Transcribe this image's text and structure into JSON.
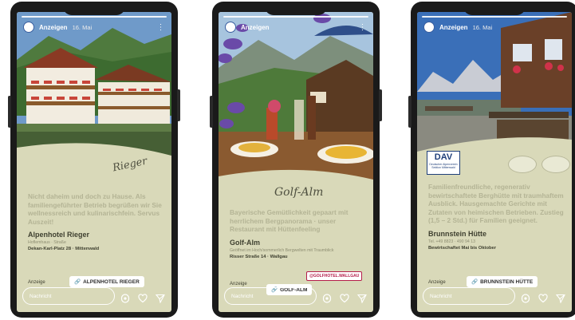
{
  "stories": [
    {
      "account": "Anzeigen",
      "date": "16. Mai",
      "description": "Nicht daheim und doch zu Hause. Als familiengeführter Betrieb begrüßen wir Sie wellnessreich und kulinarischfein. Servus Auszeit!",
      "name": "Alpenhotel Rieger",
      "address_small": "Hoflemhaus · Straße",
      "address": "Dekan-Karl-Platz 28 · Mittenwald",
      "ad_label": "Anzeige",
      "link_label": "ALPENHOTEL RIEGER",
      "reply_placeholder": "Nachricht",
      "logo_text": "Rieger"
    },
    {
      "account": "Anzeigen",
      "date": "",
      "tagline": "Golf-Alm",
      "description": "Bayerische Gemütlichkeit gepaart mit herrlichem Bergpanorama · unser Restaurant mit Hüttenfeeling",
      "name": "Golf-Alm",
      "address_small": "Geöffnet im Hoch/sommerlich Bergwelten mit Traumblick",
      "address": "Risser Straße 14 · Wallgau",
      "badge": "@GOLFHOTEL.WALLGAU",
      "ad_label": "Anzeige",
      "link_label": "GOLF-ALM",
      "reply_placeholder": "Nachricht"
    },
    {
      "account": "Anzeigen",
      "date": "16. Mai",
      "dav_label": "DAV",
      "dav_sub": "Deutscher Alpenverein Sektion Mittenwald",
      "description": "Familienfreundliche, regenerativ bewirtschaftete Berghütte mit traumhaftem Ausblick. Hausgemachte Gerichte mit Zutaten von heimischen Betrieben. Zustieg (1,5 – 2 Std.) für Familien geeignet.",
      "name": "Brunnstein Hütte",
      "address_small": "Tel. +49 8823 · 490 94 13",
      "address": "Bewirtschaftet Mai bis Oktober",
      "ad_label": "Anzeige",
      "link_label": "BRUNNSTEIN HÜTTE",
      "reply_placeholder": "Nachricht"
    }
  ],
  "colors": {
    "panel": "#d9d9b9",
    "desc": "#b4b495",
    "dark_text": "#3f4030"
  },
  "icons": [
    "camera-icon",
    "heart-icon",
    "send-icon",
    "link-icon",
    "more-icon"
  ]
}
